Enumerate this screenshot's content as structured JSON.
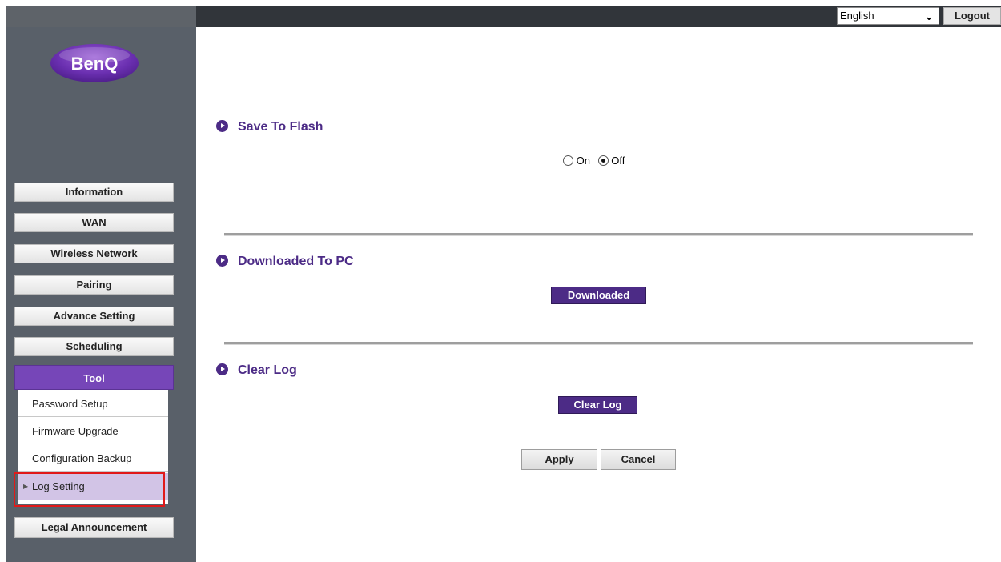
{
  "header": {
    "language_value": "English",
    "logout_label": "Logout"
  },
  "brand": {
    "logo_text": "BenQ"
  },
  "sidebar": {
    "items": [
      {
        "label": "Information"
      },
      {
        "label": "WAN"
      },
      {
        "label": "Wireless Network"
      },
      {
        "label": "Pairing"
      },
      {
        "label": "Advance Setting"
      },
      {
        "label": "Scheduling"
      },
      {
        "label": "Tool"
      },
      {
        "label": "Legal Announcement"
      }
    ],
    "active_item": "Tool",
    "tool_submenu": [
      {
        "label": "Password Setup"
      },
      {
        "label": "Firmware Upgrade"
      },
      {
        "label": "Configuration Backup"
      },
      {
        "label": "Log Setting"
      }
    ],
    "selected_subitem": "Log Setting"
  },
  "main": {
    "save_to_flash": {
      "title": "Save To Flash",
      "option_on": "On",
      "option_off": "Off",
      "selected": "Off"
    },
    "downloaded_to_pc": {
      "title": "Downloaded To PC",
      "button_label": "Downloaded"
    },
    "clear_log": {
      "title": "Clear Log",
      "button_label": "Clear Log"
    },
    "apply_label": "Apply",
    "cancel_label": "Cancel"
  },
  "colors": {
    "accent_purple": "#4c2b86",
    "active_nav": "#7646b8",
    "sidebar_bg": "#596069",
    "topbar_bg": "#31353a",
    "highlight_red": "#e11919",
    "selected_sub_bg": "#d2c4e6"
  }
}
